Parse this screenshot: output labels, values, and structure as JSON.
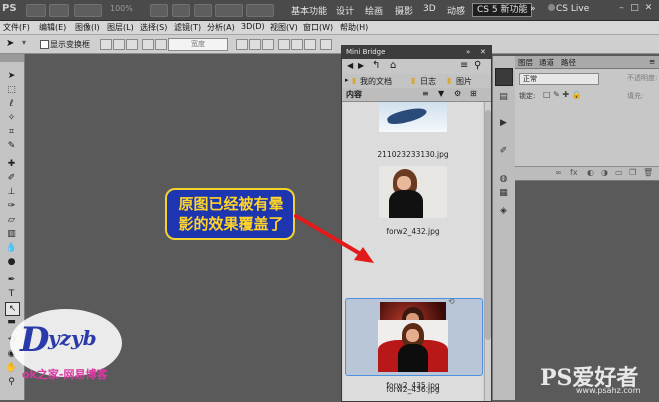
{
  "appbar": {
    "logo": "PS",
    "zoom": "100%",
    "workspaces": [
      "基本功能",
      "设计",
      "绘画",
      "摄影",
      "3D",
      "动感"
    ],
    "active_workspace": "CS 5 新功能",
    "more": "»",
    "cs_live": "CS Live"
  },
  "menubar": [
    "文件(F)",
    "编辑(E)",
    "图像(I)",
    "图层(L)",
    "选择(S)",
    "滤镜(T)",
    "分析(A)",
    "3D(D)",
    "视图(V)",
    "窗口(W)",
    "帮助(H)"
  ],
  "optbar": {
    "checkbox_label": "显示变换框",
    "field": "宽度"
  },
  "mini_bridge": {
    "title": "Mini Bridge",
    "path": [
      "我的文档",
      "日志",
      "图片"
    ],
    "content_label": "内容",
    "files": [
      {
        "name": "211023233130.jpg"
      },
      {
        "name": "forw2_432.jpg"
      },
      {
        "name": "forw2_435.jpg",
        "selected": true
      },
      {
        "name": "forw2_436.jpg"
      }
    ],
    "rating_dots": "· · · · ·"
  },
  "right_panel": {
    "tabs": [
      "图层",
      "通道",
      "路径"
    ],
    "blend_mode": "正常",
    "opacity_label": "不透明度:",
    "lock_label": "锁定:",
    "fill_label": "填充:"
  },
  "callout": {
    "line1": "原图已经被有晕",
    "line2": "影的效果覆盖了"
  },
  "watermarks": {
    "dyzyb": "Dyzyb",
    "ok": "ok之家-网易博客",
    "ps_brand": "PS爱好者",
    "ps_url": "www.psahz.com"
  },
  "colors": {
    "callout_bg": "#1e35b0",
    "callout_text": "#ffd426",
    "arrow": "#e21a1a",
    "selection": "#4f8fe0"
  }
}
